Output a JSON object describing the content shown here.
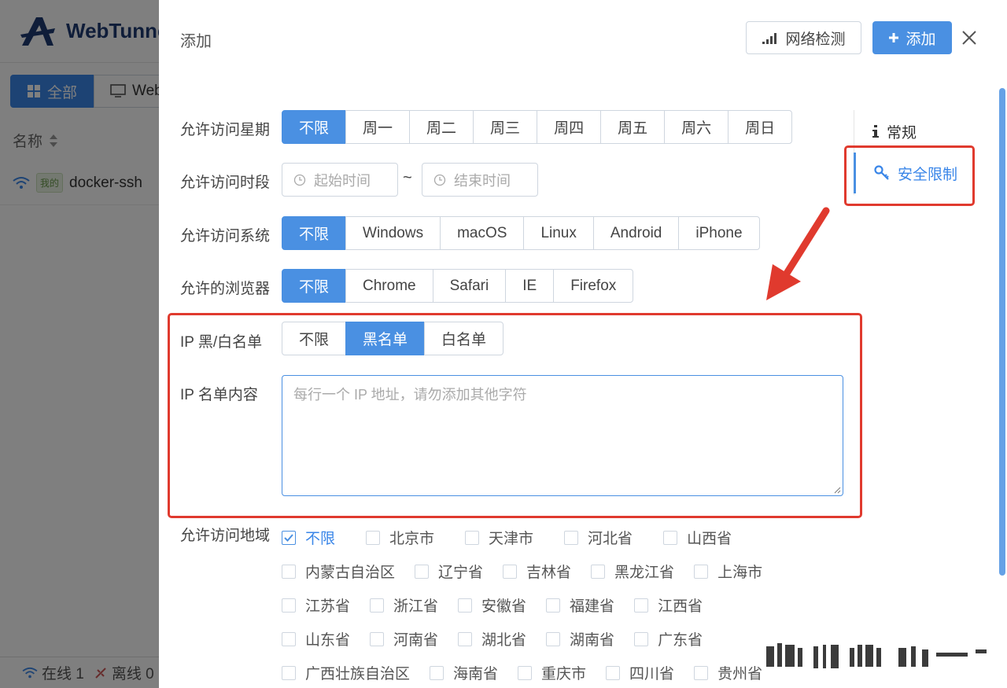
{
  "background_app": {
    "logo_text": "WebTunne",
    "filters": [
      {
        "label": "全部",
        "icon": "grid-icon"
      },
      {
        "label": "Web",
        "icon": "monitor-icon"
      }
    ],
    "column_header": "名称",
    "row": {
      "badge": "我的",
      "name": "docker-ssh"
    },
    "footer": {
      "online": "在线 1",
      "offline": "离线 0"
    }
  },
  "drawer": {
    "title": "添加",
    "network_check_label": "网络检测",
    "add_label": "添加",
    "close_icon": "close-icon"
  },
  "side_nav": {
    "general": "常规",
    "security": "安全限制"
  },
  "form": {
    "weekday": {
      "label": "允许访问星期",
      "options": [
        "不限",
        "周一",
        "周二",
        "周三",
        "周四",
        "周五",
        "周六",
        "周日"
      ],
      "selected": "不限"
    },
    "time_range": {
      "label": "允许访问时段",
      "start_placeholder": "起始时间",
      "end_placeholder": "结束时间",
      "separator": "~"
    },
    "os": {
      "label": "允许访问系统",
      "options": [
        "不限",
        "Windows",
        "macOS",
        "Linux",
        "Android",
        "iPhone"
      ],
      "selected": "不限"
    },
    "browser": {
      "label": "允许的浏览器",
      "options": [
        "不限",
        "Chrome",
        "Safari",
        "IE",
        "Firefox"
      ],
      "selected": "不限"
    },
    "ip_mode": {
      "label": "IP 黑/白名单",
      "options": [
        "不限",
        "黑名单",
        "白名单"
      ],
      "selected": "黑名单"
    },
    "ip_list": {
      "label": "IP 名单内容",
      "placeholder": "每行一个 IP 地址，请勿添加其他字符"
    },
    "region": {
      "label": "允许访问地域",
      "rows": [
        [
          "不限",
          "北京市",
          "天津市",
          "河北省",
          "山西省"
        ],
        [
          "内蒙古自治区",
          "辽宁省",
          "吉林省",
          "黑龙江省",
          "上海市"
        ],
        [
          "江苏省",
          "浙江省",
          "安徽省",
          "福建省",
          "江西省"
        ],
        [
          "山东省",
          "河南省",
          "湖北省",
          "湖南省",
          "广东省"
        ],
        [
          "广西壮族自治区",
          "海南省",
          "重庆市",
          "四川省",
          "贵州省"
        ]
      ],
      "checked": "不限"
    }
  },
  "colors": {
    "primary": "#4a90e2",
    "annotation": "#e03a2e"
  }
}
